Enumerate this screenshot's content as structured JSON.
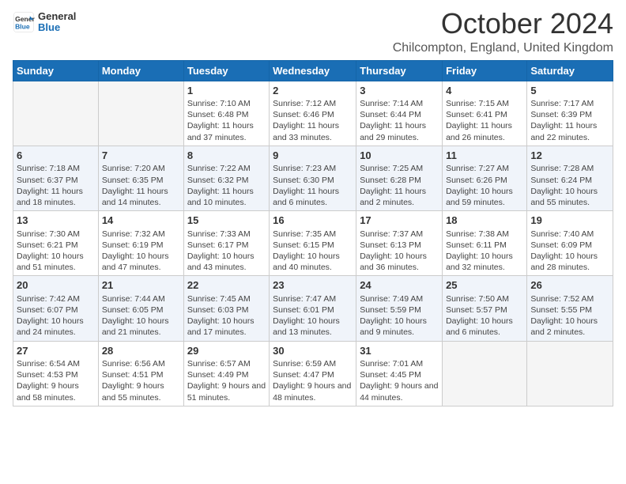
{
  "logo": {
    "line1": "General",
    "line2": "Blue"
  },
  "title": "October 2024",
  "location": "Chilcompton, England, United Kingdom",
  "weekdays": [
    "Sunday",
    "Monday",
    "Tuesday",
    "Wednesday",
    "Thursday",
    "Friday",
    "Saturday"
  ],
  "weeks": [
    [
      {
        "day": "",
        "info": ""
      },
      {
        "day": "",
        "info": ""
      },
      {
        "day": "1",
        "info": "Sunrise: 7:10 AM\nSunset: 6:48 PM\nDaylight: 11 hours and 37 minutes."
      },
      {
        "day": "2",
        "info": "Sunrise: 7:12 AM\nSunset: 6:46 PM\nDaylight: 11 hours and 33 minutes."
      },
      {
        "day": "3",
        "info": "Sunrise: 7:14 AM\nSunset: 6:44 PM\nDaylight: 11 hours and 29 minutes."
      },
      {
        "day": "4",
        "info": "Sunrise: 7:15 AM\nSunset: 6:41 PM\nDaylight: 11 hours and 26 minutes."
      },
      {
        "day": "5",
        "info": "Sunrise: 7:17 AM\nSunset: 6:39 PM\nDaylight: 11 hours and 22 minutes."
      }
    ],
    [
      {
        "day": "6",
        "info": "Sunrise: 7:18 AM\nSunset: 6:37 PM\nDaylight: 11 hours and 18 minutes."
      },
      {
        "day": "7",
        "info": "Sunrise: 7:20 AM\nSunset: 6:35 PM\nDaylight: 11 hours and 14 minutes."
      },
      {
        "day": "8",
        "info": "Sunrise: 7:22 AM\nSunset: 6:32 PM\nDaylight: 11 hours and 10 minutes."
      },
      {
        "day": "9",
        "info": "Sunrise: 7:23 AM\nSunset: 6:30 PM\nDaylight: 11 hours and 6 minutes."
      },
      {
        "day": "10",
        "info": "Sunrise: 7:25 AM\nSunset: 6:28 PM\nDaylight: 11 hours and 2 minutes."
      },
      {
        "day": "11",
        "info": "Sunrise: 7:27 AM\nSunset: 6:26 PM\nDaylight: 10 hours and 59 minutes."
      },
      {
        "day": "12",
        "info": "Sunrise: 7:28 AM\nSunset: 6:24 PM\nDaylight: 10 hours and 55 minutes."
      }
    ],
    [
      {
        "day": "13",
        "info": "Sunrise: 7:30 AM\nSunset: 6:21 PM\nDaylight: 10 hours and 51 minutes."
      },
      {
        "day": "14",
        "info": "Sunrise: 7:32 AM\nSunset: 6:19 PM\nDaylight: 10 hours and 47 minutes."
      },
      {
        "day": "15",
        "info": "Sunrise: 7:33 AM\nSunset: 6:17 PM\nDaylight: 10 hours and 43 minutes."
      },
      {
        "day": "16",
        "info": "Sunrise: 7:35 AM\nSunset: 6:15 PM\nDaylight: 10 hours and 40 minutes."
      },
      {
        "day": "17",
        "info": "Sunrise: 7:37 AM\nSunset: 6:13 PM\nDaylight: 10 hours and 36 minutes."
      },
      {
        "day": "18",
        "info": "Sunrise: 7:38 AM\nSunset: 6:11 PM\nDaylight: 10 hours and 32 minutes."
      },
      {
        "day": "19",
        "info": "Sunrise: 7:40 AM\nSunset: 6:09 PM\nDaylight: 10 hours and 28 minutes."
      }
    ],
    [
      {
        "day": "20",
        "info": "Sunrise: 7:42 AM\nSunset: 6:07 PM\nDaylight: 10 hours and 24 minutes."
      },
      {
        "day": "21",
        "info": "Sunrise: 7:44 AM\nSunset: 6:05 PM\nDaylight: 10 hours and 21 minutes."
      },
      {
        "day": "22",
        "info": "Sunrise: 7:45 AM\nSunset: 6:03 PM\nDaylight: 10 hours and 17 minutes."
      },
      {
        "day": "23",
        "info": "Sunrise: 7:47 AM\nSunset: 6:01 PM\nDaylight: 10 hours and 13 minutes."
      },
      {
        "day": "24",
        "info": "Sunrise: 7:49 AM\nSunset: 5:59 PM\nDaylight: 10 hours and 9 minutes."
      },
      {
        "day": "25",
        "info": "Sunrise: 7:50 AM\nSunset: 5:57 PM\nDaylight: 10 hours and 6 minutes."
      },
      {
        "day": "26",
        "info": "Sunrise: 7:52 AM\nSunset: 5:55 PM\nDaylight: 10 hours and 2 minutes."
      }
    ],
    [
      {
        "day": "27",
        "info": "Sunrise: 6:54 AM\nSunset: 4:53 PM\nDaylight: 9 hours and 58 minutes."
      },
      {
        "day": "28",
        "info": "Sunrise: 6:56 AM\nSunset: 4:51 PM\nDaylight: 9 hours and 55 minutes."
      },
      {
        "day": "29",
        "info": "Sunrise: 6:57 AM\nSunset: 4:49 PM\nDaylight: 9 hours and 51 minutes."
      },
      {
        "day": "30",
        "info": "Sunrise: 6:59 AM\nSunset: 4:47 PM\nDaylight: 9 hours and 48 minutes."
      },
      {
        "day": "31",
        "info": "Sunrise: 7:01 AM\nSunset: 4:45 PM\nDaylight: 9 hours and 44 minutes."
      },
      {
        "day": "",
        "info": ""
      },
      {
        "day": "",
        "info": ""
      }
    ]
  ]
}
